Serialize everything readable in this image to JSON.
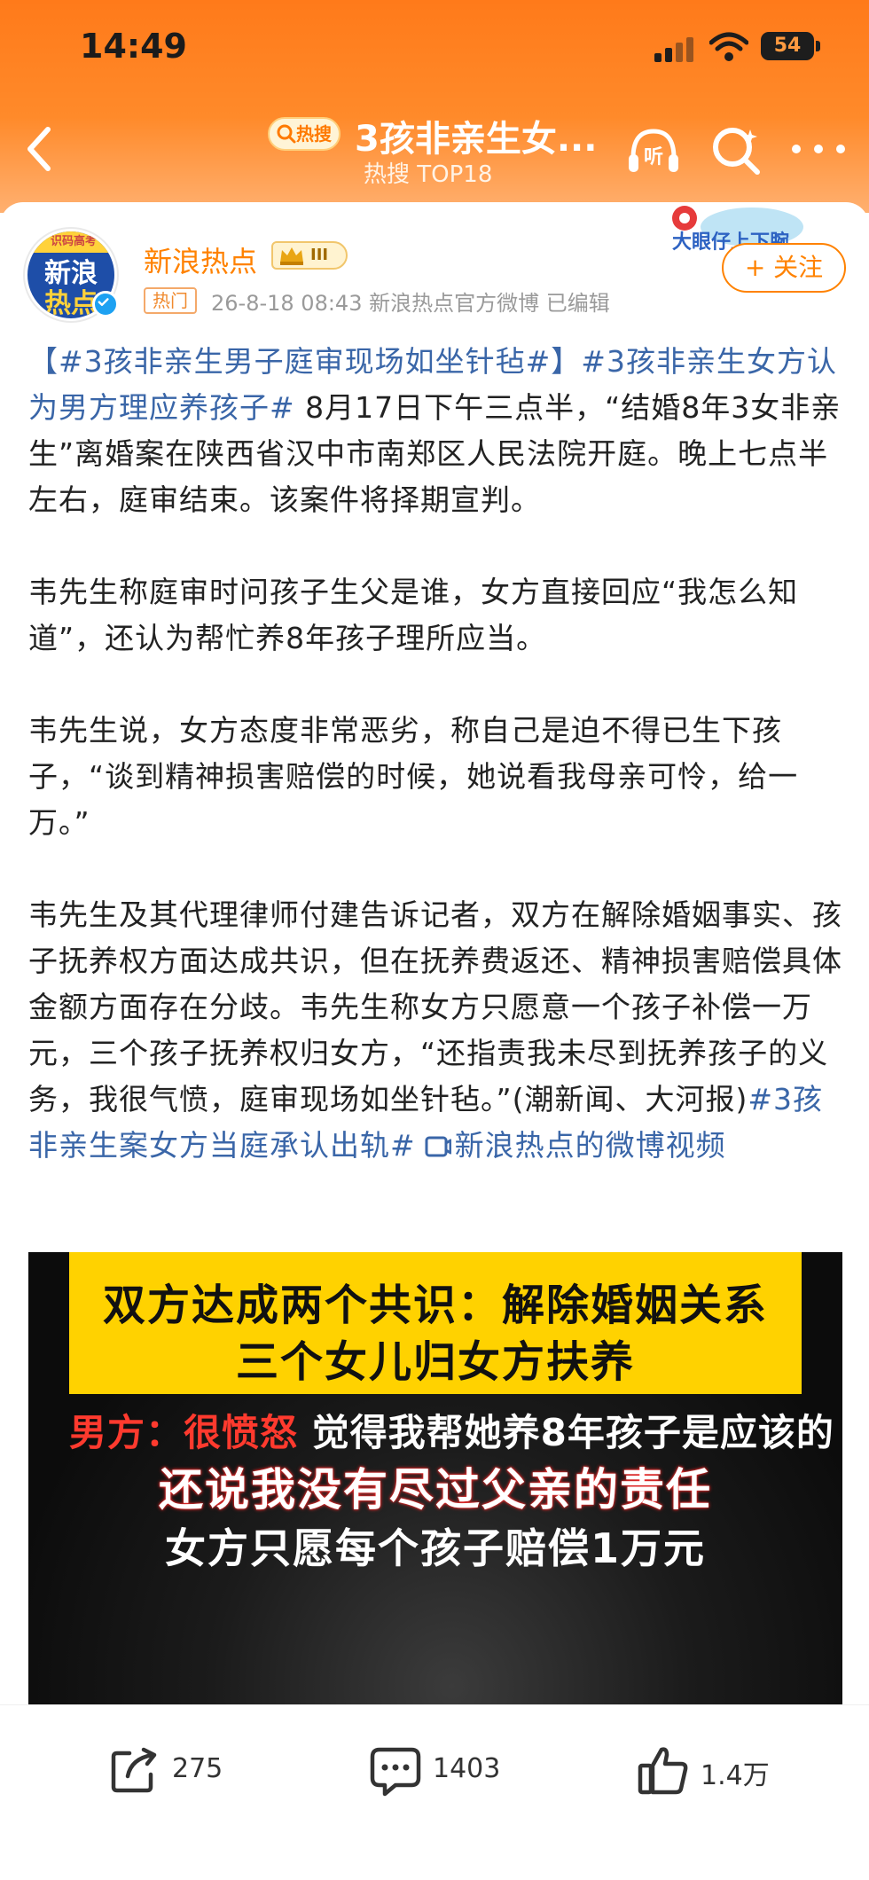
{
  "status_bar": {
    "time": "14:49",
    "battery": "54"
  },
  "nav": {
    "hot_badge": "热搜",
    "title": "3孩非亲生女...",
    "subtitle": "热搜 TOP18",
    "listen_label": "听"
  },
  "author": {
    "name": "新浪热点",
    "avatar_top": "识码高考",
    "avatar_line1": "新浪",
    "avatar_line2": "热点",
    "rank": "III",
    "tag": "热门",
    "meta": "26-8-18 08:43  新浪热点官方微博  已编辑",
    "sticker": "大眼仔上下腕",
    "follow_label": "+ 关注"
  },
  "post": {
    "p1_topic1": "【#3孩非亲生男子庭审现场如坐针毡#】",
    "p1_topic2": "#3孩非亲生女方认为男方理应养孩子#",
    "p1_text": " 8月17日下午三点半，“结婚8年3女非亲生”离婚案在陕西省汉中市南郑区人民法院开庭。晚上七点半左右，庭审结束。该案件将择期宣判。",
    "p2_text": "韦先生称庭审时问孩子生父是谁，女方直接回应“我怎么知道”，还认为帮忙养8年孩子理所应当。",
    "p3_text": "韦先生说，女方态度非常恶劣，称自己是迫不得已生下孩子，“谈到精神损害赔偿的时候，她说看我母亲可怜，给一万。”",
    "p4_text": "韦先生及其代理律师付建告诉记者，双方在解除婚姻事实、孩子抚养权方面达成共识，但在抚养费返还、精神损害赔偿具体金额方面存在分歧。韦先生称女方只愿意一个孩子补偿一万元，三个孩子抚养权归女方，“还指责我未尽到抚养孩子的义务，我很气愤，庭审现场如坐针毡。”(潮新闻、大河报)",
    "p4_topic": "#3孩非亲生案女方当庭承认出轨#",
    "p4_video_link": "新浪热点的微博视频"
  },
  "video": {
    "line1": "双方达成两个共识：解除婚姻关系",
    "line2": "三个女儿归女方扶养",
    "line3_label": "男方：",
    "line3_red": "很愤怒",
    "line3_rest": " 觉得我帮她养8年孩子是应该的",
    "line4": "还说我没有尽过父亲的责任",
    "line5": "女方只愿每个孩子赔偿1万元"
  },
  "actions": {
    "repost_count": "275",
    "comment_count": "1403",
    "like_count": "1.4万"
  },
  "colors": {
    "accent": "#ff8200",
    "topic": "#3a66a8",
    "header_start": "#ff7a1a",
    "video_banner": "#ffd200"
  },
  "icons": [
    "back-icon",
    "hot-search-icon",
    "listen-icon",
    "search-icon",
    "more-icon",
    "crown-icon",
    "verified-icon",
    "video-play-icon",
    "repost-icon",
    "comment-icon",
    "like-icon"
  ]
}
